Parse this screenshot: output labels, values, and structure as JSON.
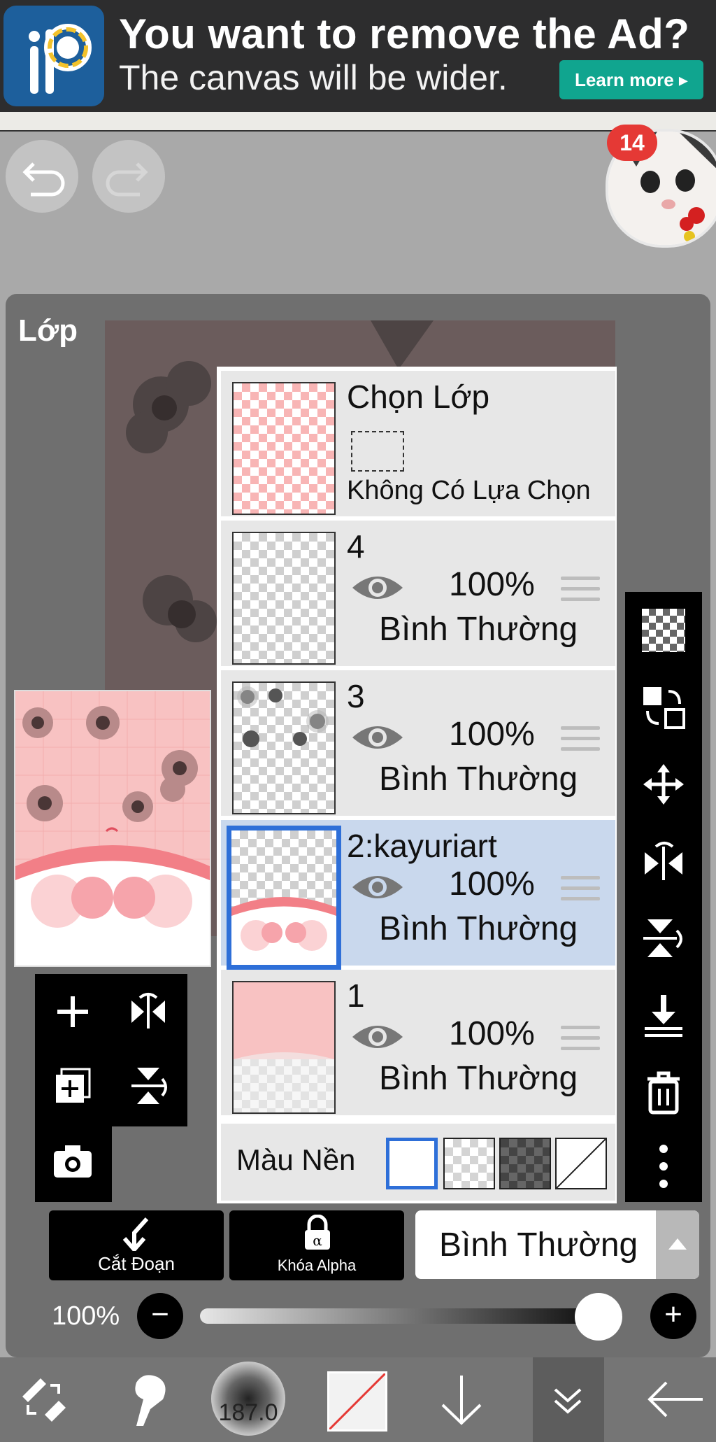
{
  "ad": {
    "title": "You want to remove the Ad?",
    "subtitle": "The canvas will be wider.",
    "button": "Learn more ▸"
  },
  "notifications": {
    "count": "14"
  },
  "panel": {
    "title": "Lớp"
  },
  "layers": [
    {
      "name": "Chọn Lớp",
      "selection_text": "Không Có Lựa Chọn"
    },
    {
      "name": "4",
      "opacity": "100%",
      "blend": "Bình Thường"
    },
    {
      "name": "3",
      "opacity": "100%",
      "blend": "Bình Thường"
    },
    {
      "name": "2:kayuriart",
      "opacity": "100%",
      "blend": "Bình Thường",
      "selected": true
    },
    {
      "name": "1",
      "opacity": "100%",
      "blend": "Bình Thường"
    }
  ],
  "background": {
    "label": "Màu Nền",
    "selected_swatch": "white"
  },
  "controls": {
    "clip_label": "Cắt Đoạn",
    "alpha_lock_label": "Khóa Alpha",
    "blend_mode": "Bình Thường",
    "opacity_label": "100%",
    "opacity_value": 1.0
  },
  "bottom_bar": {
    "brush_size": "187.0"
  },
  "colors": {
    "accent_blue": "#2e6fd8",
    "selected_row": "#c9d8ed",
    "badge_red": "#e53935",
    "ad_button": "#10a58f"
  }
}
